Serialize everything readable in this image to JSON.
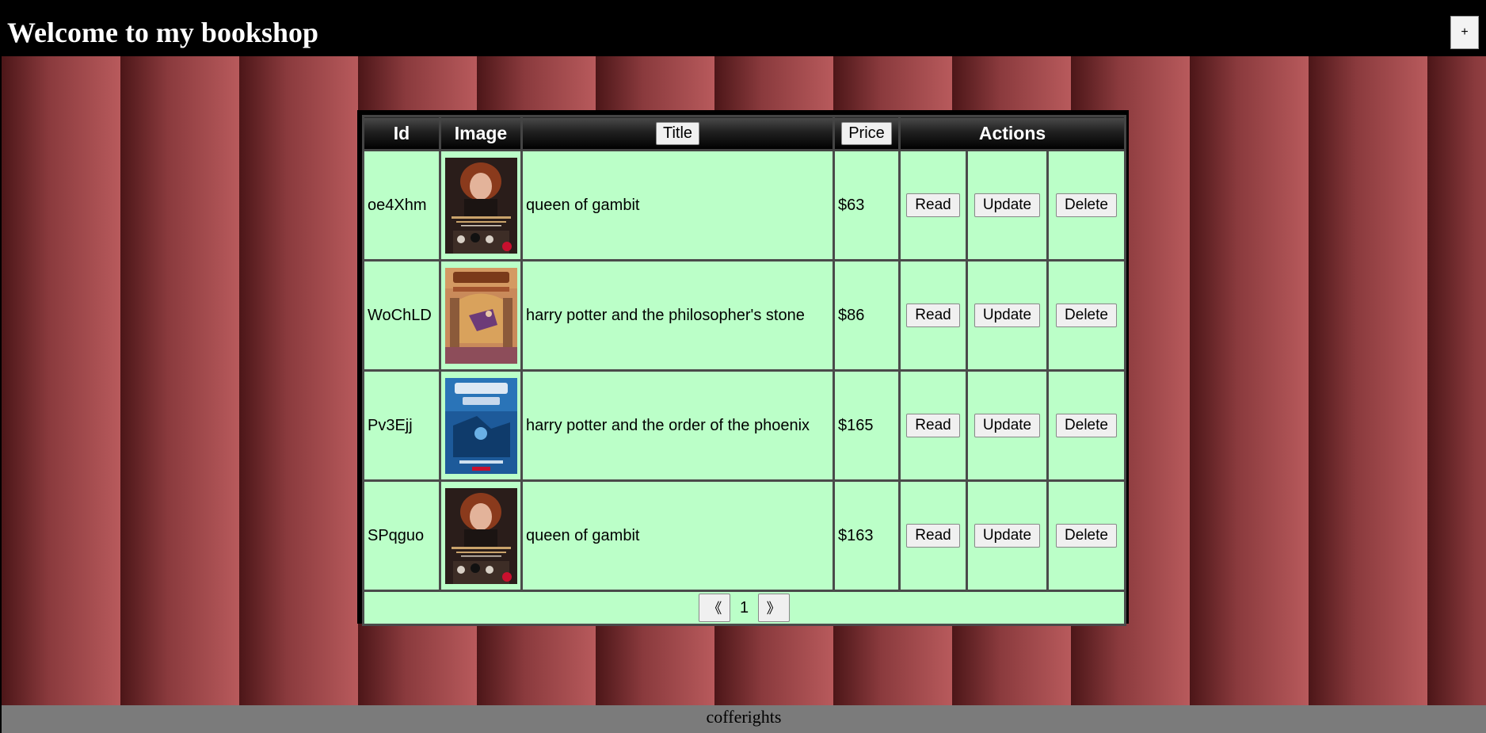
{
  "header": {
    "title": "Welcome to my bookshop",
    "add_label": "+"
  },
  "table": {
    "columns": {
      "id": "Id",
      "image": "Image",
      "title": "Title",
      "price": "Price",
      "actions": "Actions"
    },
    "rows": [
      {
        "id": "oe4Xhm",
        "cover": "queens-gambit-cover",
        "title": "queen of gambit",
        "price": "$63"
      },
      {
        "id": "WoChLD",
        "cover": "harry-potter-philosophers-stone-cover",
        "title": "harry potter and the philosopher's stone",
        "price": "$86"
      },
      {
        "id": "Pv3Ejj",
        "cover": "harry-potter-order-of-phoenix-cover",
        "title": "harry potter and the order of the phoenix",
        "price": "$165"
      },
      {
        "id": "SPqguo",
        "cover": "queens-gambit-cover",
        "title": "queen of gambit",
        "price": "$163"
      }
    ],
    "actions": {
      "read": "Read",
      "update": "Update",
      "delete": "Delete"
    }
  },
  "pagination": {
    "prev": "《",
    "page": "1",
    "next": "》"
  },
  "footer": {
    "text": "cofferights"
  },
  "colors": {
    "header_bg": "#000000",
    "row_bg": "#bbffc8",
    "footer_bg": "#7b7b7b"
  }
}
